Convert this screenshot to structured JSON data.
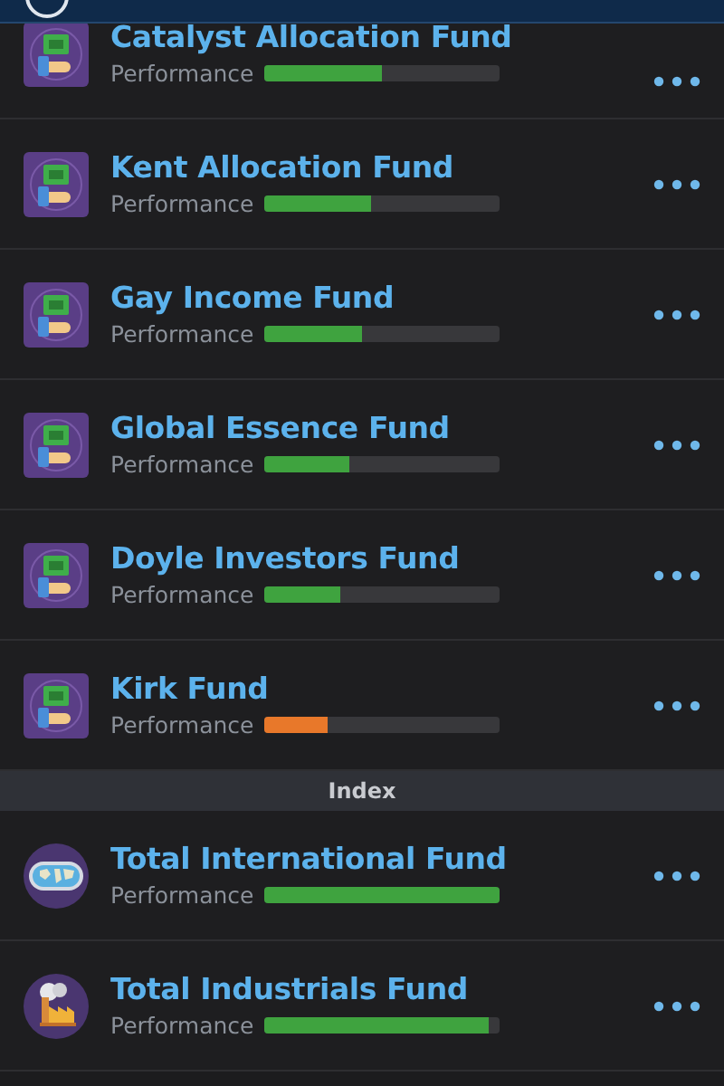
{
  "sections": [
    {
      "funds": [
        {
          "name": "Catalyst Allocation Fund",
          "kind": "allocation",
          "label": "Performance",
          "level": 0.5,
          "color": "#3fa33f"
        },
        {
          "name": "Kent Allocation Fund",
          "kind": "allocation",
          "label": "Performance",
          "level": 0.45,
          "color": "#3fa33f"
        },
        {
          "name": "Gay Income Fund",
          "kind": "allocation",
          "label": "Performance",
          "level": 0.41,
          "color": "#3fa33f"
        },
        {
          "name": "Global Essence Fund",
          "kind": "allocation",
          "label": "Performance",
          "level": 0.36,
          "color": "#3fa33f"
        },
        {
          "name": "Doyle Investors Fund",
          "kind": "allocation",
          "label": "Performance",
          "level": 0.32,
          "color": "#3fa33f"
        },
        {
          "name": "Kirk Fund",
          "kind": "allocation",
          "label": "Performance",
          "level": 0.27,
          "color": "#e8782a"
        }
      ]
    },
    {
      "title": "Index",
      "funds": [
        {
          "name": "Total International Fund",
          "kind": "globe",
          "label": "Performance",
          "level": 1.0,
          "color": "#3fa33f"
        },
        {
          "name": "Total Industrials Fund",
          "kind": "industrial",
          "label": "Performance",
          "level": 0.95,
          "color": "#3fa33f"
        }
      ]
    }
  ]
}
